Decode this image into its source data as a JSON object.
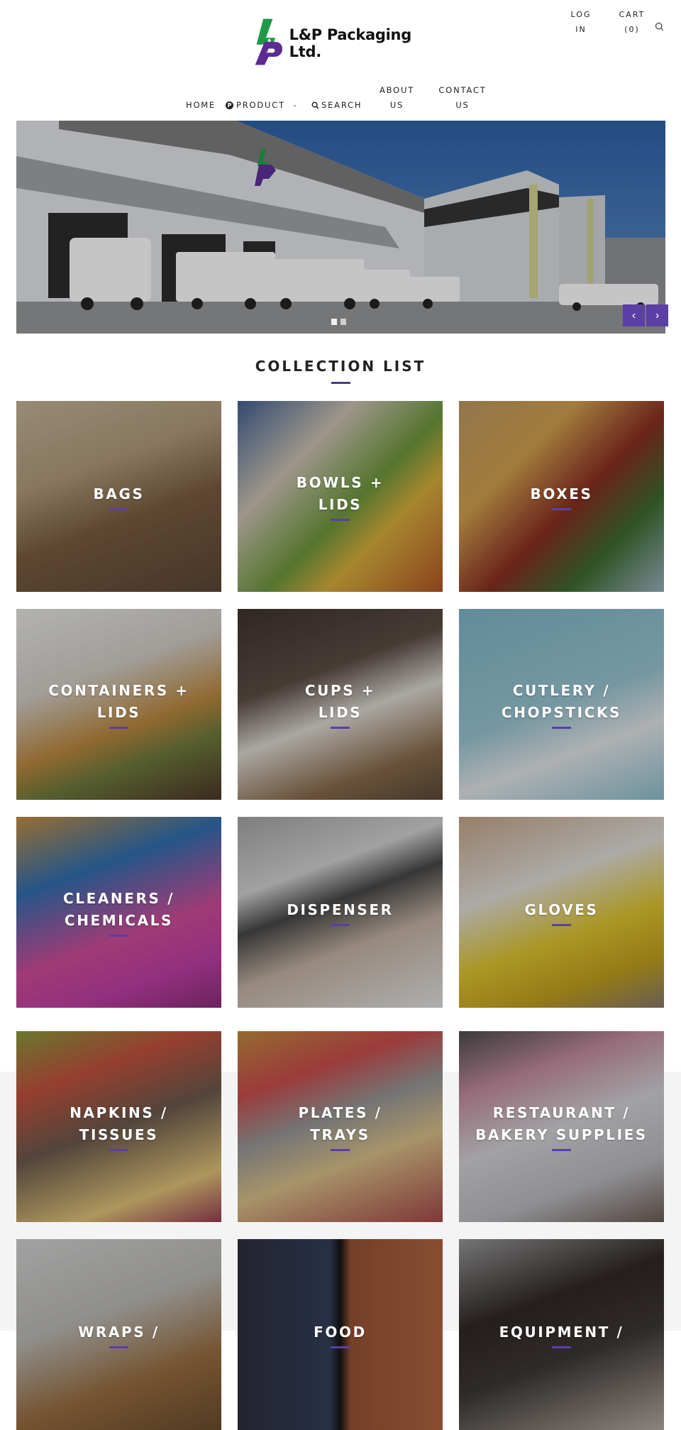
{
  "brand": {
    "name": "L&P Packaging Ltd.",
    "logo_colors": {
      "green": "#1e9a4a",
      "purple": "#5b2d91"
    }
  },
  "header": {
    "login_label_line1": "LOG",
    "login_label_line2": "IN",
    "cart_label": "CART",
    "cart_count": "(0)",
    "search_icon": "search-icon"
  },
  "nav": {
    "items": [
      {
        "label": "HOME"
      },
      {
        "label": "PRODUCT",
        "icon": "p-badge-icon",
        "has_dropdown": true,
        "dropdown_glyph": "⌄"
      },
      {
        "label": "SEARCH",
        "icon": "search-icon"
      },
      {
        "label_line1": "ABOUT",
        "label_line2": "US"
      },
      {
        "label_line1": "CONTACT",
        "label_line2": "US"
      }
    ]
  },
  "hero": {
    "slide_count": 2,
    "active_slide": 1,
    "prev_glyph": "‹",
    "next_glyph": "›",
    "accent_color": "#5b3fa6"
  },
  "collection": {
    "title": "COLLECTION LIST",
    "accent_color": "#4b3a8c",
    "items": [
      {
        "label": "BAGS"
      },
      {
        "label": "BOWLS +\nLIDS"
      },
      {
        "label": "BOXES"
      },
      {
        "label": "CONTAINERS +\nLIDS"
      },
      {
        "label": "CUPS +\nLIDS"
      },
      {
        "label": "CUTLERY /\nCHOPSTICKS"
      },
      {
        "label": "CLEANERS /\nCHEMICALS"
      },
      {
        "label": "DISPENSER"
      },
      {
        "label": "GLOVES"
      },
      {
        "label": "NAPKINS /\nTISSUES"
      },
      {
        "label": "PLATES /\nTRAYS"
      },
      {
        "label": "RESTAURANT /\nBAKERY SUPPLIES"
      },
      {
        "label": "WRAPS /"
      },
      {
        "label": "FOOD"
      },
      {
        "label": "EQUIPMENT /"
      }
    ]
  }
}
